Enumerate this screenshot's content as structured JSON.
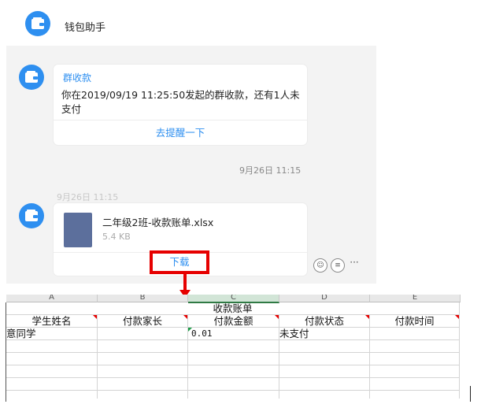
{
  "header": {
    "title": "钱包助手"
  },
  "chat": {
    "collection_card": {
      "title": "群收款",
      "body": "你在2019/09/19 11:25:50发起的群收款，还有1人未支付",
      "action": "去提醒一下"
    },
    "timestamp_1": "9月26日 11:15",
    "timestamp_2": "9月26日 11:15",
    "file_card": {
      "file_name": "二年级2班-收款账单.xlsx",
      "file_size": "5.4 KB",
      "download_label": "下载"
    },
    "actions": {
      "emoji": "☺",
      "reply": "≡",
      "more": "···"
    }
  },
  "spreadsheet": {
    "columns": [
      "A",
      "B",
      "C",
      "D",
      "E"
    ],
    "selected_column": "C",
    "title": "收款账单",
    "headers": [
      "学生姓名",
      "付款家长",
      "付款金额",
      "付款状态",
      "付款时间"
    ],
    "rows": [
      [
        "意同学",
        "",
        "0.01",
        "未支付",
        ""
      ]
    ]
  },
  "colors": {
    "accent": "#2e8ff0",
    "highlight": "#e60000",
    "file_icon": "#5c6f9c"
  }
}
